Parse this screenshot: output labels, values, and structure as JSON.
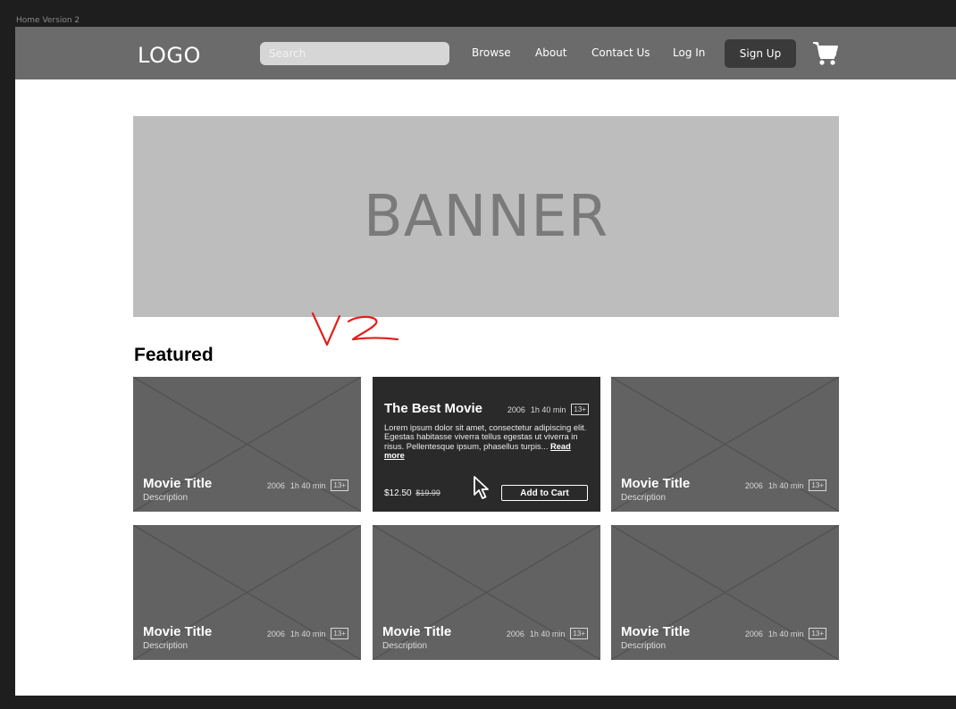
{
  "frame": {
    "label": "Home Version 2"
  },
  "header": {
    "logo": "LOGO",
    "search_placeholder": "Search",
    "nav": [
      "Browse",
      "About",
      "Contact Us",
      "Log In"
    ],
    "signup": "Sign Up"
  },
  "banner": {
    "text": "BANNER"
  },
  "section": {
    "title": "Featured"
  },
  "hover_card": {
    "title": "The Best Movie",
    "year": "2006",
    "runtime": "1h 40 min",
    "rating": "13+",
    "description": "Lorem ipsum dolor sit amet, consectetur adipiscing elit. Egestas habitasse viverra tellus egestas ut viverra in risus. Pellentesque ipsum, phasellus turpis... ",
    "read_more": "Read more",
    "price": "$12.50",
    "old_price": "$19.99",
    "add_to_cart": "Add to Cart"
  },
  "cards": [
    {
      "title": "Movie Title",
      "description": "Description",
      "year": "2006",
      "runtime": "1h 40 min",
      "rating": "13+"
    },
    {
      "title": "Movie Title",
      "description": "Description",
      "year": "2006",
      "runtime": "1h 40 min",
      "rating": "13+"
    },
    {
      "title": "Movie Title",
      "description": "Description",
      "year": "2006",
      "runtime": "1h 40 min",
      "rating": "13+"
    },
    {
      "title": "Movie Title",
      "description": "Description",
      "year": "2006",
      "runtime": "1h 40 min",
      "rating": "13+"
    },
    {
      "title": "Movie Title",
      "description": "Description",
      "year": "2006",
      "runtime": "1h 40 min",
      "rating": "13+"
    }
  ],
  "annotation": {
    "icon": "handwritten-v2-mark",
    "color": "#e0201a"
  },
  "icons": {
    "cart": "cart-icon",
    "cursor": "mouse-pointer-icon"
  }
}
